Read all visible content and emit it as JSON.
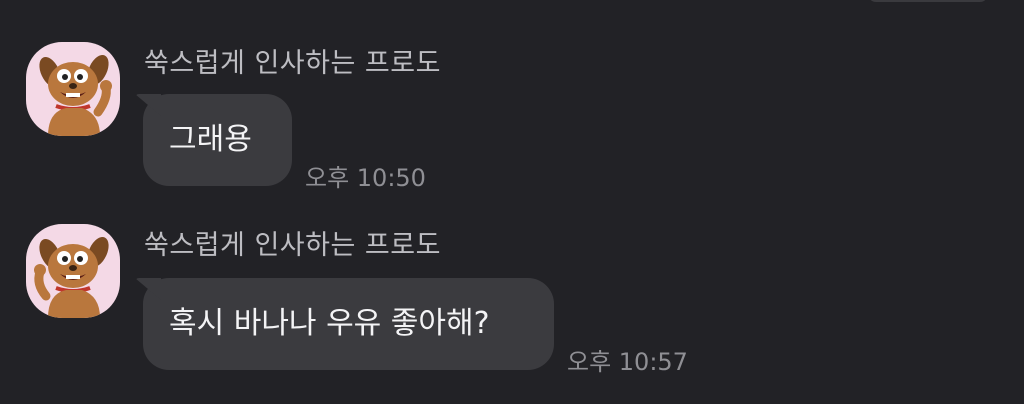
{
  "messages": [
    {
      "sender": "쑥스럽게 인사하는 프로도",
      "text": "그래용",
      "time": "오후 10:50",
      "avatar_icon": "frodo-dog-avatar-icon"
    },
    {
      "sender": "쑥스럽게 인사하는 프로도",
      "text": "혹시 바나나 우유 좋아해?",
      "time": "오후 10:57",
      "avatar_icon": "frodo-dog-avatar-icon"
    }
  ],
  "colors": {
    "background": "#222226",
    "bubble": "#3b3b3f",
    "avatar_bg": "#f4d9e6",
    "sender_text": "#bdbdc2",
    "time_text": "#8f8f94",
    "message_text": "#f4f4f6"
  }
}
